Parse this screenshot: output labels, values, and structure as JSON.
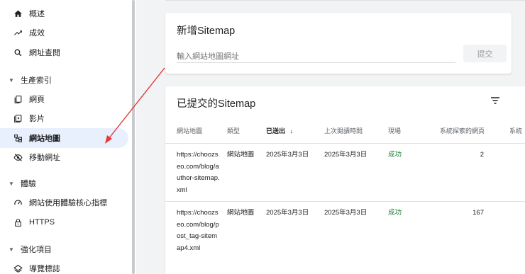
{
  "sidebar": {
    "items": [
      {
        "label": "概述",
        "icon": "home-icon"
      },
      {
        "label": "成效",
        "icon": "trending-up-icon"
      },
      {
        "label": "網址查閱",
        "icon": "search-icon"
      }
    ],
    "groups": [
      {
        "label": "生產索引"
      },
      {
        "label": "體驗"
      },
      {
        "label": "強化項目"
      }
    ],
    "index_items": [
      {
        "label": "網頁",
        "icon": "pages-icon"
      },
      {
        "label": "影片",
        "icon": "video-icon"
      },
      {
        "label": "網站地圖",
        "icon": "sitemap-icon"
      },
      {
        "label": "移動網址",
        "icon": "removals-icon"
      }
    ],
    "experience_items": [
      {
        "label": "網站使用體驗核心指標",
        "icon": "speedometer-icon"
      },
      {
        "label": "HTTPS",
        "icon": "lock-icon"
      }
    ],
    "enhancement_items": [
      {
        "label": "導覽標誌",
        "icon": "layers-icon"
      }
    ]
  },
  "add_sitemap": {
    "title": "新增Sitemap",
    "placeholder": "輸入網站地圖網址",
    "submit_label": "提交"
  },
  "submitted": {
    "title": "已提交的Sitemap",
    "columns": [
      "網站地圖",
      "類型",
      "已送出",
      "上次閱讀時間",
      "現場",
      "系統探索的網頁",
      "系統"
    ],
    "sort_arrow": "↓",
    "rows": [
      {
        "url": "https://choozseo.com/blog/author-sitemap.xml",
        "type": "網站地圖",
        "submitted": "2025年3月3日",
        "last_read": "2025年3月3日",
        "status": "成功",
        "pages": "2"
      },
      {
        "url": "https://choozseo.com/blog/post_tag-sitemap4.xml",
        "type": "網站地圖",
        "submitted": "2025年3月3日",
        "last_read": "2025年3月3日",
        "status": "成功",
        "pages": "167"
      }
    ]
  },
  "colors": {
    "active_bg": "#e8f0fe",
    "success": "#188038",
    "annotation_arrow": "#e53935"
  }
}
